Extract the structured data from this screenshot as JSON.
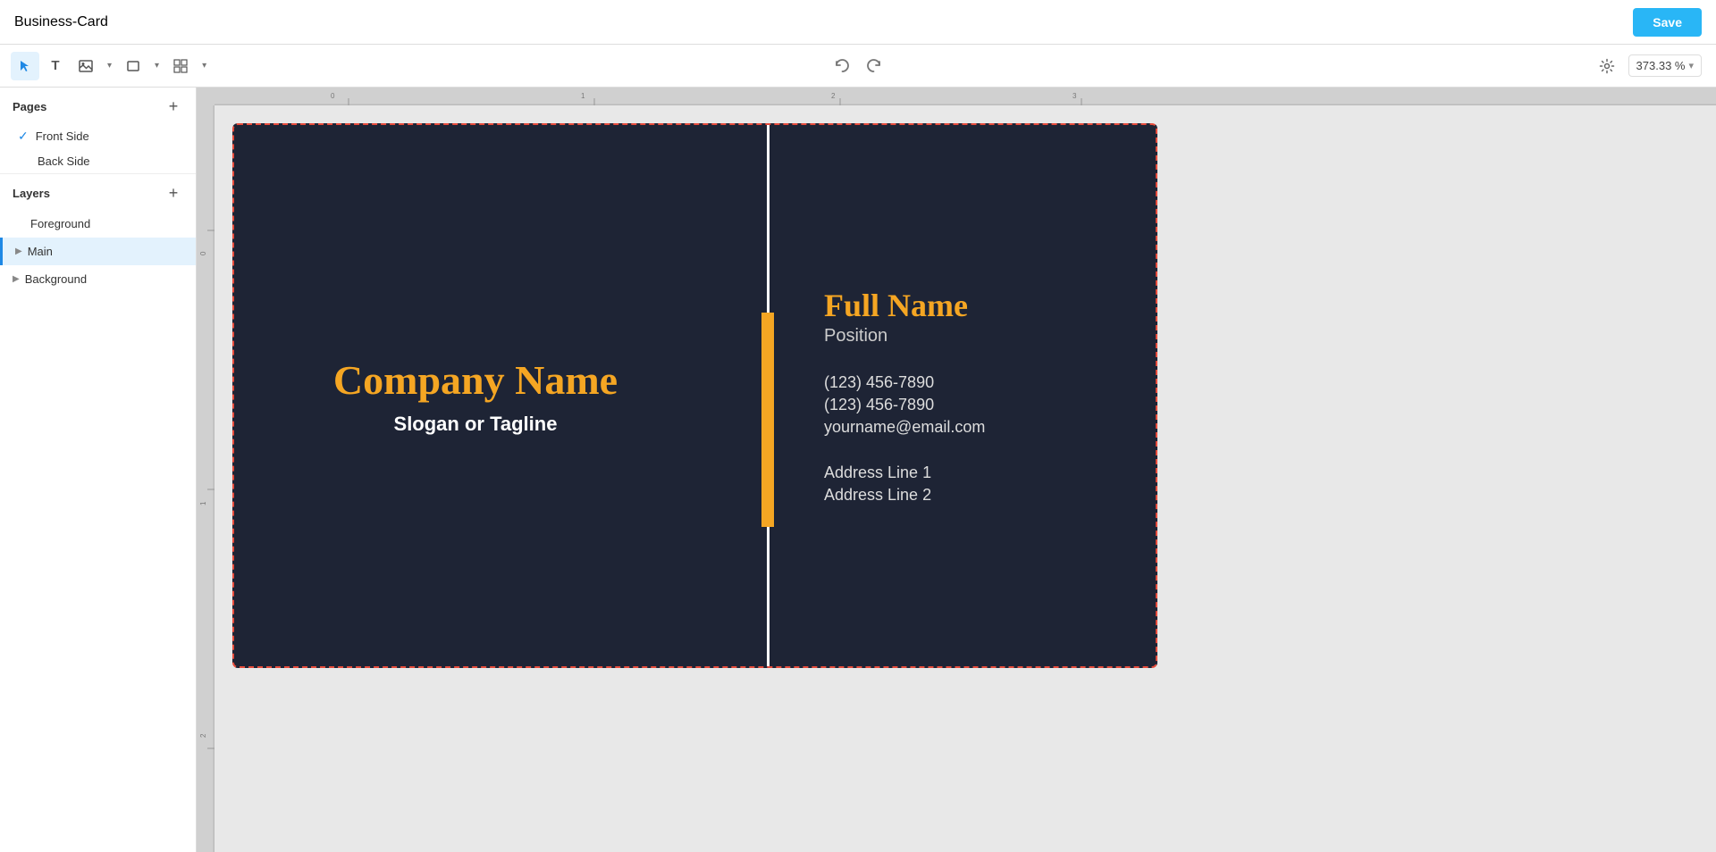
{
  "app": {
    "title": "Business-Card",
    "save_button": "Save"
  },
  "toolbar": {
    "undo_label": "↺",
    "redo_label": "↻",
    "zoom": "373.33 %",
    "zoom_chevron": "▾",
    "tools": [
      {
        "name": "select",
        "icon": "▶",
        "active": true
      },
      {
        "name": "text",
        "icon": "T",
        "active": false
      },
      {
        "name": "image",
        "icon": "⊞",
        "active": false
      },
      {
        "name": "shape",
        "icon": "▭",
        "active": false
      },
      {
        "name": "grid",
        "icon": "⊞⊞",
        "active": false
      }
    ]
  },
  "sidebar": {
    "pages_label": "Pages",
    "add_page_label": "+",
    "pages": [
      {
        "name": "Front Side",
        "active": true
      },
      {
        "name": "Back Side",
        "active": false
      }
    ],
    "layers_label": "Layers",
    "add_layer_label": "+",
    "layers": [
      {
        "name": "Foreground",
        "active": false,
        "expandable": false
      },
      {
        "name": "Main",
        "active": true,
        "expandable": true
      },
      {
        "name": "Background",
        "active": false,
        "expandable": true
      }
    ]
  },
  "card": {
    "company_name": "Company Name",
    "slogan": "Slogan or Tagline",
    "full_name": "Full Name",
    "position": "Position",
    "phone1": "(123) 456-7890",
    "phone2": "(123) 456-7890",
    "email": "yourname@email.com",
    "address1": "Address Line 1",
    "address2": "Address Line 2"
  },
  "colors": {
    "card_bg": "#1e2435",
    "accent": "#f5a623",
    "text_light": "#ffffff",
    "text_muted": "#cccccc",
    "save_btn": "#29b6f6"
  }
}
